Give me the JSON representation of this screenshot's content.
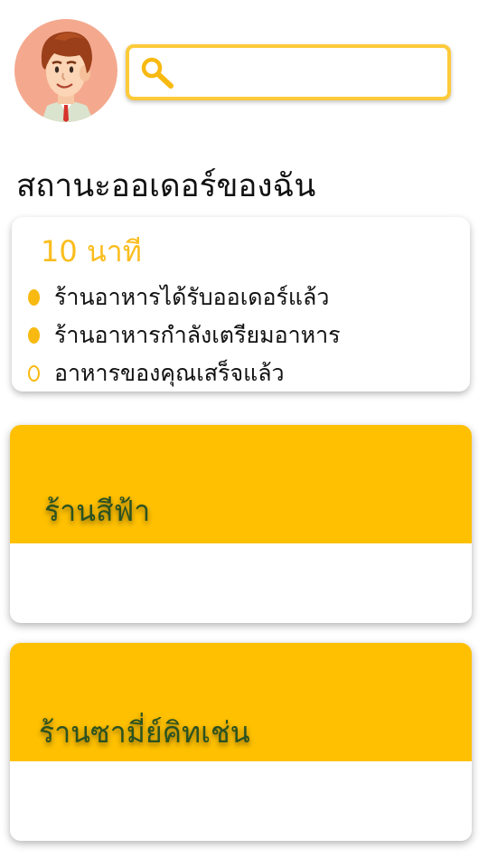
{
  "header": {
    "avatar_icon": "user-avatar-icon",
    "search": {
      "icon": "search-icon",
      "value": "",
      "placeholder": ""
    }
  },
  "page_title": "สถานะออเดอร์ของฉัน",
  "status_card": {
    "eta": "10 นาที",
    "steps": [
      {
        "label": "ร้านอาหารได้รับออเดอร์แล้ว",
        "state": "done"
      },
      {
        "label": "ร้านอาหารกำลังเตรียมอาหาร",
        "state": "done"
      },
      {
        "label": "อาหารของคุณเสร็จแล้ว",
        "state": "pending"
      }
    ]
  },
  "restaurants": [
    {
      "name": "ร้านสีฟ้า"
    },
    {
      "name": "ร้านซามี่ย์คิทเช่น"
    }
  ],
  "colors": {
    "accent": "#fec000",
    "eta": "#fbbd1e",
    "restaurant_name": "#2b5222",
    "avatar_bg": "#f4a98f"
  }
}
